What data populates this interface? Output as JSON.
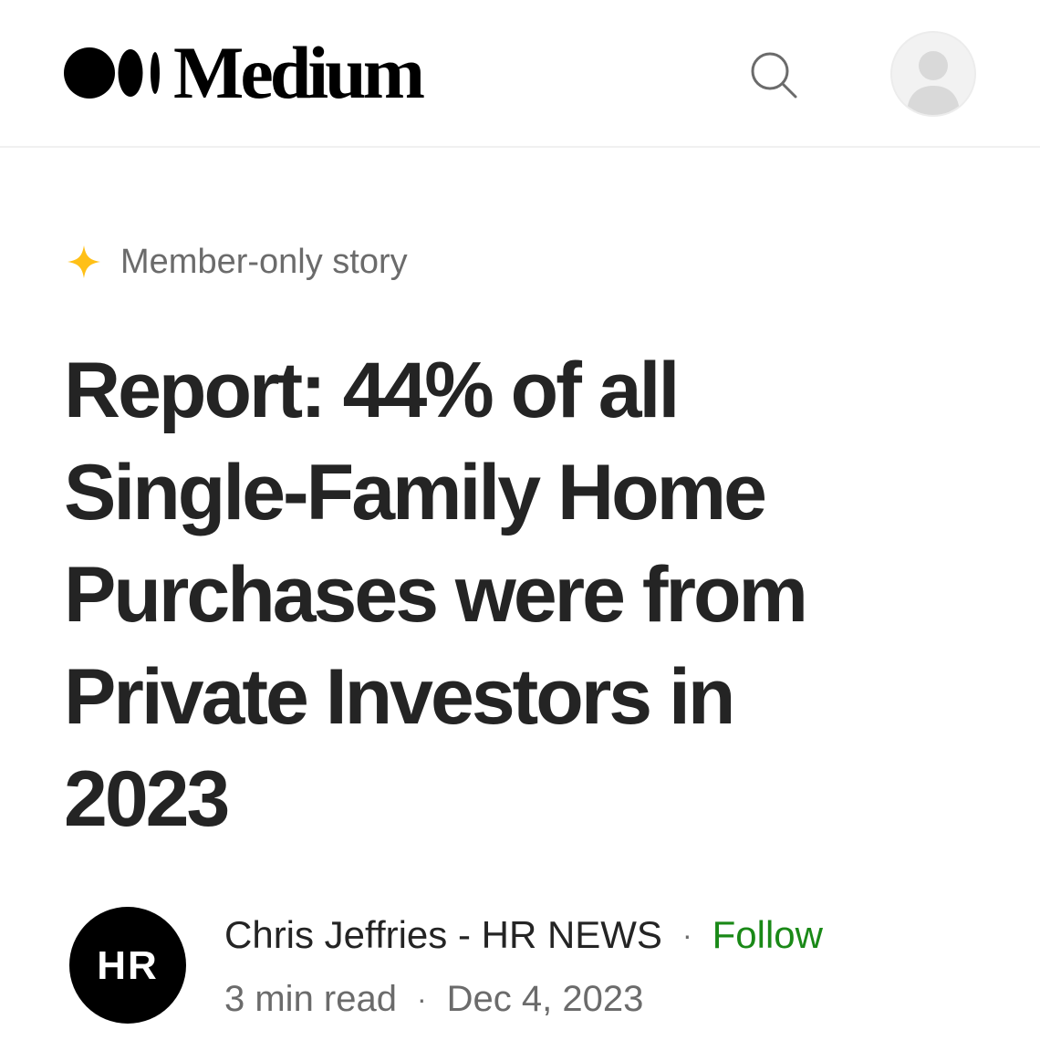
{
  "header": {
    "logo_text": "Medium",
    "icons": {
      "logo": "medium-dots-logo",
      "search": "search-icon",
      "avatar": "user-avatar-icon"
    }
  },
  "story": {
    "member_label": "Member-only story",
    "star_color": "#ffc017",
    "title_lines": [
      "Report: 44% of all",
      "Single-Family Home",
      "Purchases were from",
      "Private Investors in",
      "2023"
    ]
  },
  "author": {
    "name": "Chris Jeffries - HR NEWS",
    "separator": "·",
    "follow_label": "Follow",
    "follow_color": "#1a8917",
    "avatar_text": "HR",
    "read_time": "3 min read",
    "date": "Dec 4, 2023"
  }
}
